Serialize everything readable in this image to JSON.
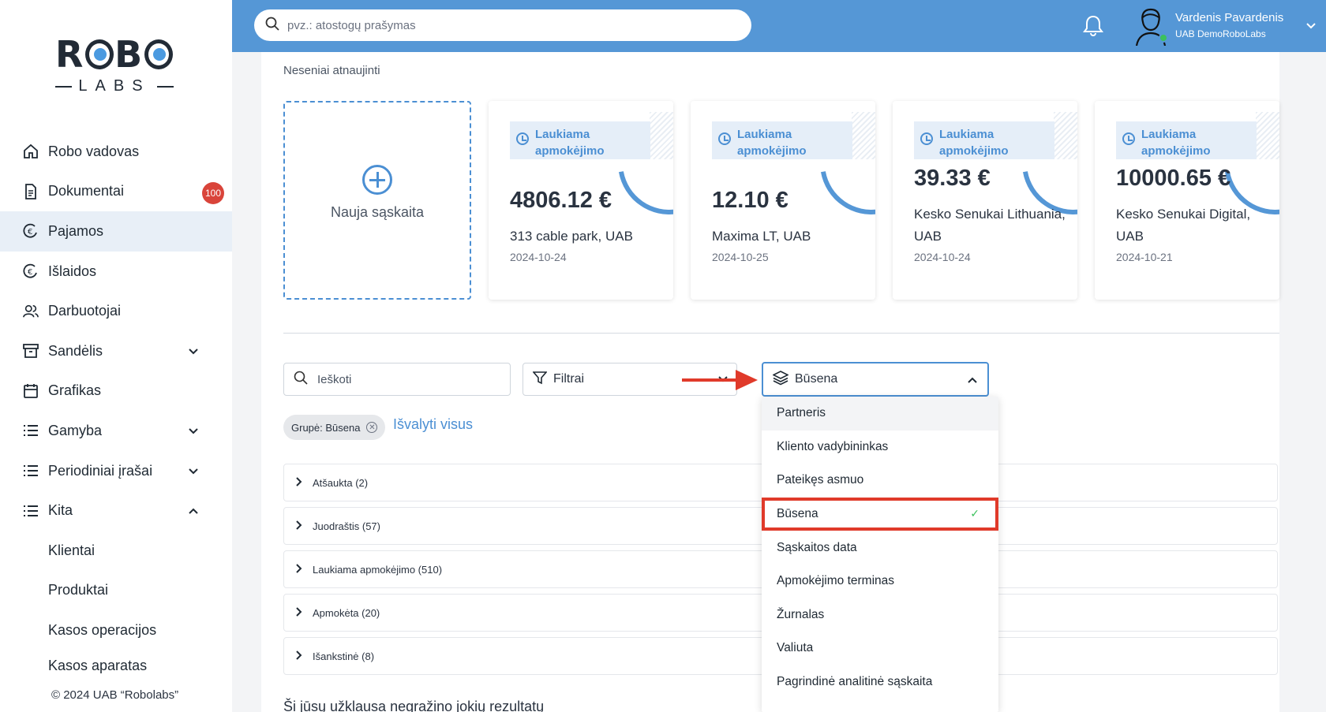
{
  "sidebar": {
    "logo_top": "ROBO",
    "logo_bottom": "LABS",
    "items": [
      {
        "label": "Robo vadovas"
      },
      {
        "label": "Dokumentai",
        "badge": "100"
      },
      {
        "label": "Pajamos"
      },
      {
        "label": "Išlaidos"
      },
      {
        "label": "Darbuotojai"
      },
      {
        "label": "Sandėlis"
      },
      {
        "label": "Grafikas"
      },
      {
        "label": "Gamyba"
      },
      {
        "label": "Periodiniai įrašai"
      },
      {
        "label": "Kita"
      },
      {
        "label": "Klientai"
      },
      {
        "label": "Produktai"
      },
      {
        "label": "Kasos operacijos"
      },
      {
        "label": "Kasos aparatas"
      }
    ],
    "footer": "© 2024 UAB “Robolabs”"
  },
  "header": {
    "search_placeholder": "pvz.: atostogų prašymas",
    "user_name": "Vardenis Pavardenis",
    "user_company": "UAB DemoRoboLabs"
  },
  "main": {
    "section_title": "Neseniai atnaujinti",
    "new_invoice_label": "Nauja sąskaita",
    "invoices": [
      {
        "status": "Laukiama apmokėjimo",
        "amount": "4806.12 €",
        "partner": "313 cable park, UAB",
        "date": "2024-10-24"
      },
      {
        "status": "Laukiama apmokėjimo",
        "amount": "12.10 €",
        "partner": "Maxima LT, UAB",
        "date": "2024-10-25"
      },
      {
        "status": "Laukiama apmokėjimo",
        "amount": "39.33 €",
        "partner": "Kesko Senukai Lithuania, UAB",
        "date": "2024-10-24"
      },
      {
        "status": "Laukiama apmokėjimo",
        "amount": "10000.65 €",
        "partner": "Kesko Senukai Digital, UAB",
        "date": "2024-10-21"
      }
    ],
    "search_placeholder": "Ieškoti",
    "filter_label": "Filtrai",
    "group_label": "Būsena",
    "chip_label": "Grupė: Būsena",
    "clear_all": "Išvalyti visus",
    "groups": [
      "Atšaukta (2)",
      "Juodraštis (57)",
      "Laukiama apmokėjimo (510)",
      "Apmokėta (20)",
      "Išankstinė (8)"
    ],
    "no_results": "Ši jūsų užklausa negražino jokių rezultatų"
  },
  "dropdown": {
    "options": [
      "Partneris",
      "Kliento vadybininkas",
      "Pateikęs asmuo",
      "Būsena",
      "Sąskaitos data",
      "Apmokėjimo terminas",
      "Žurnalas",
      "Valiuta",
      "Pagrindinė analitinė sąskaita"
    ],
    "selected": "Būsena"
  },
  "colors": {
    "header_blue": "#5597d6",
    "accent_blue": "#4b8fd3",
    "badge_red": "#d9443a",
    "highlight_red": "#e03a2a",
    "check_green": "#3bc15c"
  }
}
